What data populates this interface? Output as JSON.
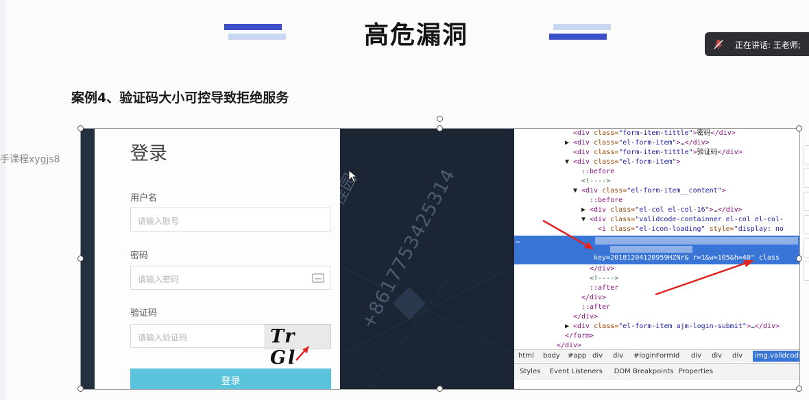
{
  "slide": {
    "title": "高危漏洞",
    "subtitle": "案例4、验证码大小可控导致拒绝服务",
    "left_watermark": "手课程xygjs8"
  },
  "speaking": {
    "label": "正在讲话: 王老师;"
  },
  "login": {
    "title": "登录",
    "username_label": "用户名",
    "username_placeholder": "请输入账号",
    "password_label": "密码",
    "password_placeholder": "请输入密码",
    "captcha_label": "验证码",
    "captcha_placeholder": "请输入验证码",
    "captcha_text": "Tr Gl",
    "login_button": "登录"
  },
  "image_watermark": {
    "phone": "+8617753425314",
    "name": "桂园"
  },
  "devtools": {
    "lines": [
      {
        "indent": 0,
        "arrow": "",
        "parts": [
          [
            "tag",
            "<div "
          ],
          [
            "attr",
            "class="
          ],
          [
            "val",
            "\"form-item-tittle\""
          ],
          [
            "tag",
            ">"
          ],
          [
            "plain",
            "密码"
          ],
          [
            "tag",
            "</div>"
          ]
        ]
      },
      {
        "indent": 0,
        "arrow": "▶",
        "parts": [
          [
            "tag",
            "<div "
          ],
          [
            "attr",
            "class="
          ],
          [
            "val",
            "\"el-form-item\""
          ],
          [
            "tag",
            ">"
          ],
          [
            "plain",
            "…"
          ],
          [
            "tag",
            "</div>"
          ]
        ]
      },
      {
        "indent": 0,
        "arrow": "",
        "parts": [
          [
            "tag",
            "<div "
          ],
          [
            "attr",
            "class="
          ],
          [
            "val",
            "\"form-item-tittle\""
          ],
          [
            "tag",
            ">"
          ],
          [
            "plain",
            "验证码"
          ],
          [
            "tag",
            "</div>"
          ]
        ]
      },
      {
        "indent": 0,
        "arrow": "▼",
        "parts": [
          [
            "tag",
            "<div "
          ],
          [
            "attr",
            "class="
          ],
          [
            "val",
            "\"el-form-item\""
          ],
          [
            "tag",
            ">"
          ]
        ]
      },
      {
        "indent": 1,
        "arrow": "",
        "parts": [
          [
            "tag",
            "::before"
          ]
        ]
      },
      {
        "indent": 1,
        "arrow": "",
        "parts": [
          [
            "cmt",
            "<!---->"
          ]
        ]
      },
      {
        "indent": 1,
        "arrow": "▼",
        "parts": [
          [
            "tag",
            "<div "
          ],
          [
            "attr",
            "class="
          ],
          [
            "val",
            "\"el-form-item__content\""
          ],
          [
            "tag",
            ">"
          ]
        ]
      },
      {
        "indent": 2,
        "arrow": "",
        "parts": [
          [
            "tag",
            "::before"
          ]
        ]
      },
      {
        "indent": 2,
        "arrow": "▶",
        "parts": [
          [
            "tag",
            "<div "
          ],
          [
            "attr",
            "class="
          ],
          [
            "val",
            "\"el-col el-col-16\""
          ],
          [
            "tag",
            ">"
          ],
          [
            "plain",
            "…"
          ],
          [
            "tag",
            "</div>"
          ]
        ]
      },
      {
        "indent": 2,
        "arrow": "▼",
        "parts": [
          [
            "tag",
            "<div "
          ],
          [
            "attr",
            "class="
          ],
          [
            "val",
            "\"validcode-containner el-col el-col-"
          ]
        ]
      },
      {
        "indent": 3,
        "arrow": "",
        "parts": [
          [
            "tag",
            "<i "
          ],
          [
            "attr",
            "class="
          ],
          [
            "val",
            "\"el-icon-loading\""
          ],
          [
            "attr",
            " style="
          ],
          [
            "val",
            "\"display: no"
          ]
        ]
      }
    ],
    "selected_line": "key=20181204120959HZNr& r=1&w=105&h=40\"  class",
    "after_lines": [
      {
        "indent": 2,
        "arrow": "",
        "parts": [
          [
            "tag",
            "</div>"
          ]
        ]
      },
      {
        "indent": 2,
        "arrow": "",
        "parts": [
          [
            "cmt",
            "<!---->"
          ]
        ]
      },
      {
        "indent": 2,
        "arrow": "",
        "parts": [
          [
            "tag",
            "::after"
          ]
        ]
      },
      {
        "indent": 1,
        "arrow": "",
        "parts": [
          [
            "tag",
            "</div>"
          ]
        ]
      },
      {
        "indent": 1,
        "arrow": "",
        "parts": [
          [
            "tag",
            "::after"
          ]
        ]
      },
      {
        "indent": 0,
        "arrow": "",
        "parts": [
          [
            "tag",
            "</div>"
          ]
        ]
      },
      {
        "indent": 0,
        "arrow": "▶",
        "parts": [
          [
            "tag",
            "<div "
          ],
          [
            "attr",
            "class="
          ],
          [
            "val",
            "\"el-form-item ajm-login-submit\""
          ],
          [
            "tag",
            ">"
          ],
          [
            "plain",
            "…"
          ],
          [
            "tag",
            "</div>"
          ]
        ]
      },
      {
        "indent": -1,
        "arrow": "",
        "parts": [
          [
            "tag",
            "</form>"
          ]
        ]
      },
      {
        "indent": -2,
        "arrow": "",
        "parts": [
          [
            "tag",
            "</div>"
          ]
        ]
      }
    ],
    "breadcrumbs": [
      "html",
      "body",
      "#app",
      "div",
      "div",
      "#loginFormId",
      "div",
      "div",
      "div",
      "img.validcode"
    ],
    "panel_tabs": [
      "Styles",
      "Event Listeners",
      "DOM Breakpoints",
      "Properties"
    ],
    "colors": {
      "selection": "#3875d7",
      "arrow": "#e02424"
    }
  }
}
